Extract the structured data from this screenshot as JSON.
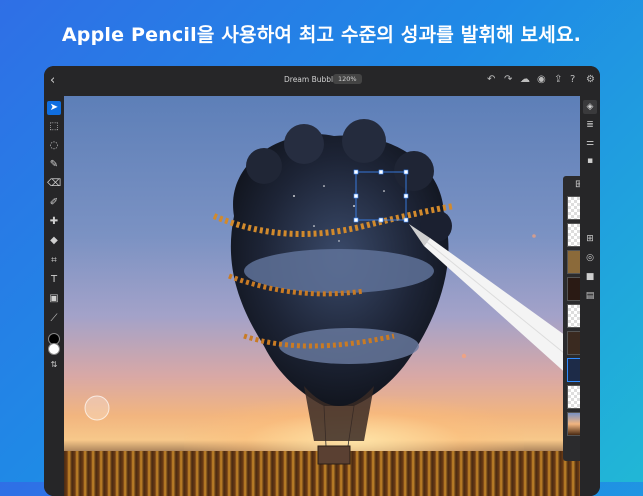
{
  "headline": "Apple Pencil을 사용하여 최고 수준의 성과를 발휘해 보세요.",
  "app": {
    "document_title": "Dream Bubble",
    "zoom_level": "120%"
  },
  "top_bar": {
    "left": [
      {
        "name": "back-icon",
        "glyph": "‹"
      }
    ],
    "right": [
      {
        "name": "undo-icon",
        "glyph": "↶"
      },
      {
        "name": "redo-icon",
        "glyph": "↷"
      },
      {
        "name": "cloud-icon",
        "glyph": "☁"
      },
      {
        "name": "user-icon",
        "glyph": "◉"
      },
      {
        "name": "share-icon",
        "glyph": "⇪"
      },
      {
        "name": "help-icon",
        "glyph": "?"
      },
      {
        "name": "settings-icon",
        "glyph": "⚙"
      }
    ]
  },
  "left_tools": [
    {
      "name": "select-tool-icon",
      "glyph": "➤",
      "active": true
    },
    {
      "name": "transform-tool-icon",
      "glyph": "⬚"
    },
    {
      "name": "lasso-tool-icon",
      "glyph": "◌"
    },
    {
      "name": "brush-tool-icon",
      "glyph": "✎"
    },
    {
      "name": "eraser-tool-icon",
      "glyph": "⌫"
    },
    {
      "name": "clone-tool-icon",
      "glyph": "✐"
    },
    {
      "name": "healing-tool-icon",
      "glyph": "✚"
    },
    {
      "name": "fill-tool-icon",
      "glyph": "◆"
    },
    {
      "name": "crop-tool-icon",
      "glyph": "⌗"
    },
    {
      "name": "type-tool-icon",
      "glyph": "T"
    },
    {
      "name": "image-tool-icon",
      "glyph": "▣"
    },
    {
      "name": "eyedropper-tool-icon",
      "glyph": "⟋"
    }
  ],
  "right_tools": [
    {
      "name": "layers-icon",
      "glyph": "◈",
      "active": true
    },
    {
      "name": "layer-properties-icon",
      "glyph": "≣"
    },
    {
      "name": "adjustments-icon",
      "glyph": "⚌"
    },
    {
      "name": "comments-icon",
      "glyph": "▪"
    },
    {
      "name": "add-layer-icon",
      "glyph": "⊞"
    },
    {
      "name": "visibility-icon",
      "glyph": "◎"
    },
    {
      "name": "mask-icon",
      "glyph": "■"
    },
    {
      "name": "lock-icon",
      "glyph": "▤"
    }
  ],
  "colors": {
    "foreground": "#000000",
    "background": "#ffffff",
    "accent": "#0f6ee0"
  },
  "layers": [
    {
      "name": "empty-layer"
    },
    {
      "name": "empty-layer"
    },
    {
      "name": "sunflower-crown-layer"
    },
    {
      "name": "portrait-layer"
    },
    {
      "name": "empty-layer"
    },
    {
      "name": "balloon-basket-layer"
    },
    {
      "name": "moon-layer",
      "selected": true
    },
    {
      "name": "empty-layer"
    },
    {
      "name": "sunset-background-layer"
    }
  ]
}
